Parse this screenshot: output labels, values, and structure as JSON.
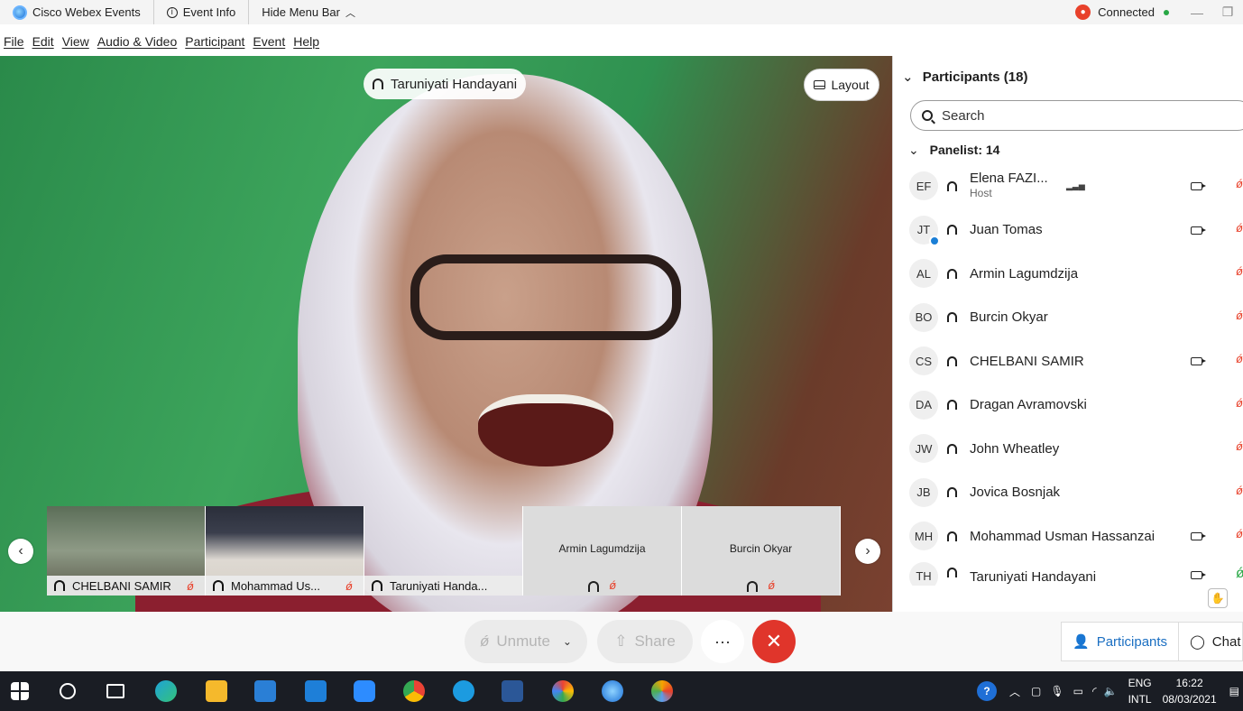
{
  "titlebar": {
    "app_name": "Cisco Webex Events",
    "event_info": "Event Info",
    "hide_menu": "Hide Menu Bar",
    "status": "Connected",
    "minimize": "—",
    "restore": "❐"
  },
  "menu": [
    "File",
    "Edit",
    "View",
    "Audio & Video",
    "Participant",
    "Event",
    "Help"
  ],
  "stage": {
    "active_speaker": "Taruniyati Handayani",
    "layout_label": "Layout"
  },
  "thumbnails": [
    {
      "name": "CHELBANI SAMIR",
      "video": true,
      "muted": true
    },
    {
      "name": "Mohammad Us...",
      "video": true,
      "muted": true
    },
    {
      "name": "Taruniyati Handa...",
      "video": false,
      "muted": false
    },
    {
      "name": "Armin Lagumdzija",
      "video": false,
      "muted": true
    },
    {
      "name": "Burcin Okyar",
      "video": false,
      "muted": true
    }
  ],
  "participants": {
    "heading": "Participants (18)",
    "search_placeholder": "Search",
    "group_label": "Panelist: 14",
    "rows": [
      {
        "initials": "EF",
        "name": "Elena FAZI...",
        "role": "Host",
        "camera": true,
        "mic": "muted"
      },
      {
        "initials": "JT",
        "name": "Juan Tomas",
        "role": "",
        "camera": true,
        "mic": "muted",
        "badge": true
      },
      {
        "initials": "AL",
        "name": "Armin Lagumdzija",
        "role": "",
        "camera": false,
        "mic": "muted"
      },
      {
        "initials": "BO",
        "name": "Burcin Okyar",
        "role": "",
        "camera": false,
        "mic": "muted"
      },
      {
        "initials": "CS",
        "name": "CHELBANI SAMIR",
        "role": "",
        "camera": true,
        "mic": "muted"
      },
      {
        "initials": "DA",
        "name": "Dragan Avramovski",
        "role": "",
        "camera": false,
        "mic": "muted"
      },
      {
        "initials": "JW",
        "name": "John Wheatley",
        "role": "",
        "camera": false,
        "mic": "muted"
      },
      {
        "initials": "JB",
        "name": "Jovica Bosnjak",
        "role": "",
        "camera": false,
        "mic": "muted"
      },
      {
        "initials": "MH",
        "name": "Mohammad Usman Hassanzai",
        "role": "",
        "camera": true,
        "mic": "muted"
      },
      {
        "initials": "TH",
        "name": "Taruniyati Handayani",
        "role": "",
        "camera": true,
        "mic": "on"
      }
    ]
  },
  "controls": {
    "unmute": "Unmute",
    "share": "Share",
    "more": "···",
    "end": "✕",
    "participants_tab": "Participants",
    "chat_tab": "Chat"
  },
  "taskbar": {
    "lang1": "ENG",
    "lang2": "INTL",
    "time": "16:22",
    "date": "08/03/2021"
  },
  "colors": {
    "accent": "#1b6fc2",
    "end_call": "#e0352b",
    "muted": "#e8412b",
    "connected": "#28a745"
  }
}
